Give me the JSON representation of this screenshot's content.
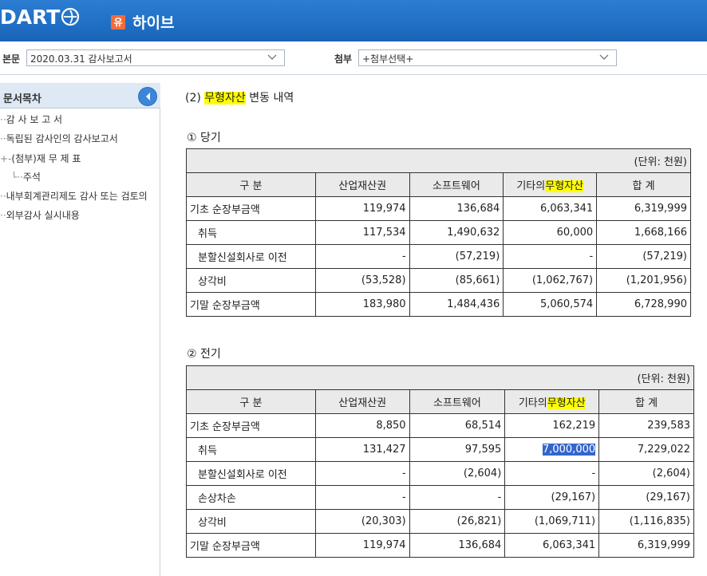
{
  "header": {
    "logo_text": "DART",
    "corp_badge": "유",
    "company_name": "하이브",
    "colors": {
      "header_bg": "#1f6fc5",
      "badge": "#f36b3b"
    }
  },
  "toolbar": {
    "main_label": "본문",
    "main_select_value": "2020.03.31  감사보고서",
    "attach_label": "첨부",
    "attach_select_value": "+첨부선택+"
  },
  "sidebar": {
    "title": "문서목차",
    "items": [
      {
        "label": "감 사 보 고 서",
        "prefix": "··"
      },
      {
        "label": "독립된 감사인의 감사보고서",
        "prefix": "··"
      },
      {
        "label": "(첨부)재 무 제 표",
        "prefix": "+-"
      },
      {
        "label": "주석",
        "prefix": "└··"
      },
      {
        "label": "내부회계관리제도 감사 또는 검토의",
        "prefix": "··"
      },
      {
        "label": "외부감사 실시내용",
        "prefix": "··"
      }
    ]
  },
  "content": {
    "section_prefix": "(2) ",
    "section_highlight": "무형자산",
    "section_suffix": " 변동 내역",
    "unit_text": "(단위: 천원)",
    "columns": {
      "category": "구  분",
      "c1": "산업재산권",
      "c2": "소프트웨어",
      "c3_prefix": "기타의",
      "c3_highlight": "무형자산",
      "c4": "합  계"
    },
    "current": {
      "title": "① 당기",
      "rows": [
        {
          "label": "기초 순장부금액",
          "indent": false,
          "v": [
            "119,974",
            "136,684",
            "6,063,341",
            "6,319,999"
          ]
        },
        {
          "label": "취득",
          "indent": true,
          "v": [
            "117,534",
            "1,490,632",
            "60,000",
            "1,668,166"
          ]
        },
        {
          "label": "분할신설회사로 이전",
          "indent": true,
          "v": [
            "-",
            "(57,219)",
            "-",
            "(57,219)"
          ]
        },
        {
          "label": "상각비",
          "indent": true,
          "v": [
            "(53,528)",
            "(85,661)",
            "(1,062,767)",
            "(1,201,956)"
          ]
        },
        {
          "label": "기말 순장부금액",
          "indent": false,
          "v": [
            "183,980",
            "1,484,436",
            "5,060,574",
            "6,728,990"
          ]
        }
      ]
    },
    "prior": {
      "title": "② 전기",
      "rows": [
        {
          "label": "기초 순장부금액",
          "indent": false,
          "v": [
            "8,850",
            "68,514",
            "162,219",
            "239,583"
          ]
        },
        {
          "label": "취득",
          "indent": true,
          "v": [
            "131,427",
            "97,595",
            "7,000,000",
            "7,229,022"
          ]
        },
        {
          "label": "분할신설회사로 이전",
          "indent": true,
          "v": [
            "-",
            "(2,604)",
            "-",
            "(2,604)"
          ]
        },
        {
          "label": "손상차손",
          "indent": true,
          "v": [
            "-",
            "-",
            "(29,167)",
            "(29,167)"
          ]
        },
        {
          "label": "상각비",
          "indent": true,
          "v": [
            "(20,303)",
            "(26,821)",
            "(1,069,711)",
            "(1,116,835)"
          ]
        },
        {
          "label": "기말 순장부금액",
          "indent": false,
          "v": [
            "119,974",
            "136,684",
            "6,063,341",
            "6,319,999"
          ]
        }
      ]
    }
  }
}
